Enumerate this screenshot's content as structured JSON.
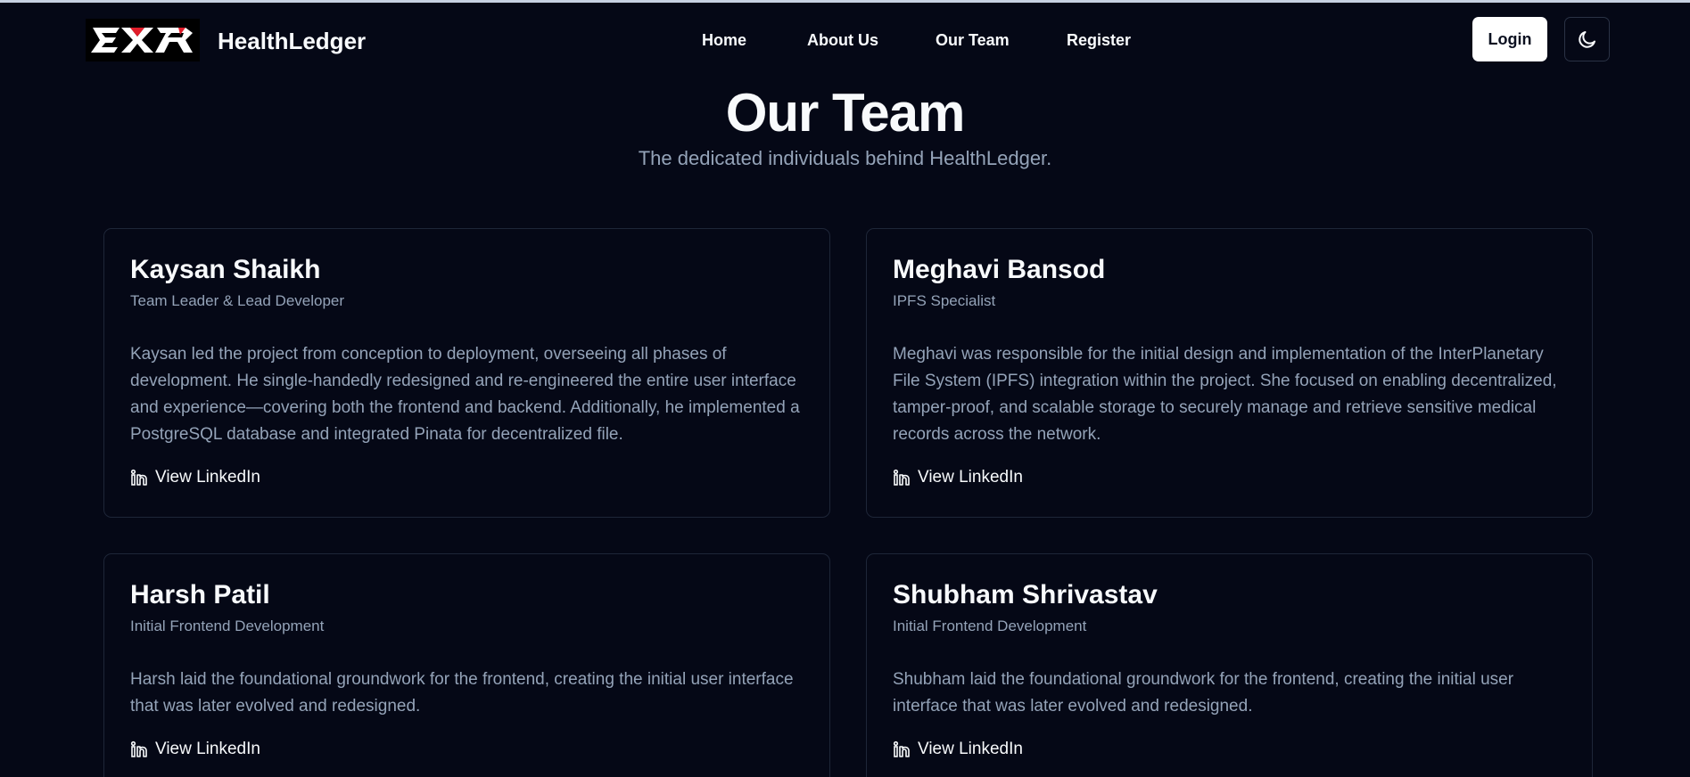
{
  "header": {
    "brand": "HealthLedger",
    "nav": [
      "Home",
      "About Us",
      "Our Team",
      "Register"
    ],
    "login_label": "Login",
    "logo_icon": "exr-logo",
    "theme_icon": "moon-icon"
  },
  "hero": {
    "title": "Our Team",
    "subtitle": "The dedicated individuals behind HealthLedger."
  },
  "team": [
    {
      "name": "Kaysan Shaikh",
      "role": "Team Leader & Lead Developer",
      "description": "Kaysan led the project from conception to deployment, overseeing all phases of development. He single-handedly redesigned and re-engineered the entire user interface and experience—covering both the frontend and backend. Additionally, he implemented a PostgreSQL database and integrated Pinata for decentralized file.",
      "link_label": "View LinkedIn"
    },
    {
      "name": "Meghavi Bansod",
      "role": "IPFS Specialist",
      "description": "Meghavi was responsible for the initial design and implementation of the InterPlanetary File System (IPFS) integration within the project. She focused on enabling decentralized, tamper-proof, and scalable storage to securely manage and retrieve sensitive medical records across the network.",
      "link_label": "View LinkedIn"
    },
    {
      "name": "Harsh Patil",
      "role": "Initial Frontend Development",
      "description": "Harsh laid the foundational groundwork for the frontend, creating the initial user interface that was later evolved and redesigned.",
      "link_label": "View LinkedIn"
    },
    {
      "name": "Shubham Shrivastav",
      "role": "Initial Frontend Development",
      "description": "Shubham laid the foundational groundwork for the frontend, creating the initial user interface that was later evolved and redesigned.",
      "link_label": "View LinkedIn"
    }
  ],
  "colors": {
    "background": "#050816",
    "text": "#f8fafc",
    "muted": "#94a3b8",
    "border": "#1e2638"
  }
}
